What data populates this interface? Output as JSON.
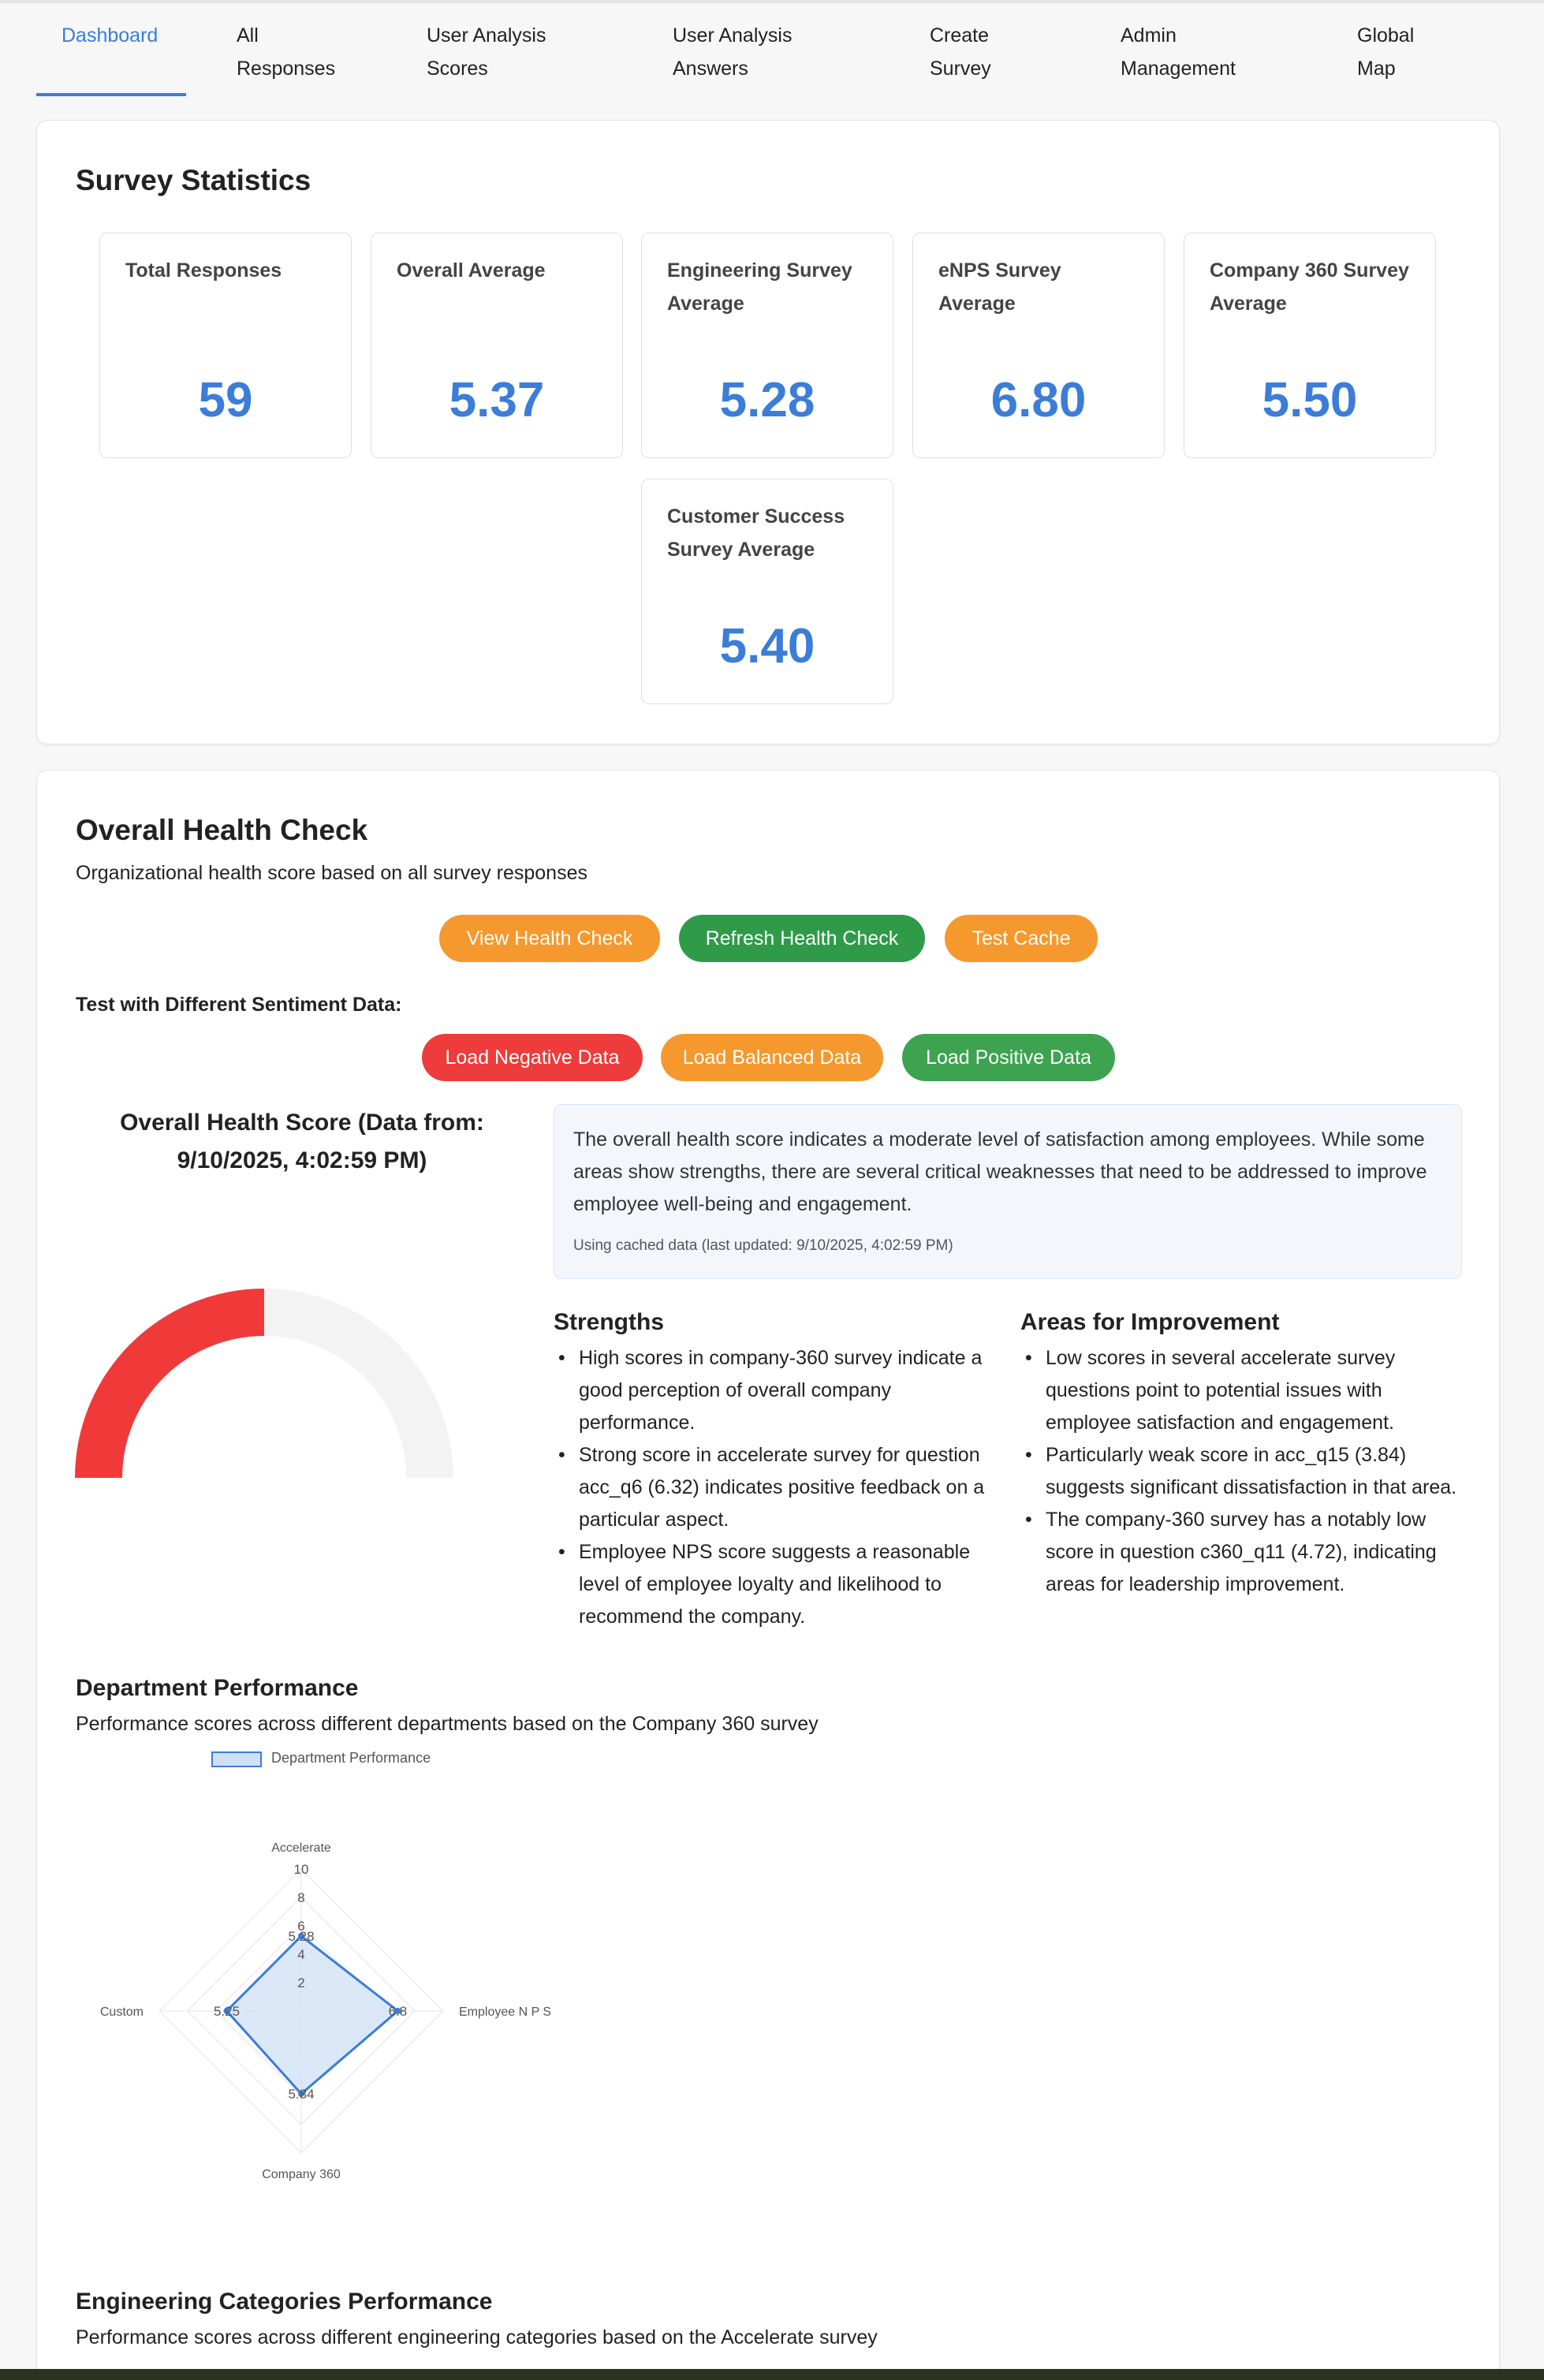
{
  "nav": {
    "tabs": [
      {
        "line1": "Dashboard",
        "line2": ""
      },
      {
        "line1": "All",
        "line2": "Responses"
      },
      {
        "line1": "User Analysis",
        "line2": "Scores"
      },
      {
        "line1": "User Analysis",
        "line2": "Answers"
      },
      {
        "line1": "Create",
        "line2": "Survey"
      },
      {
        "line1": "Admin",
        "line2": "Management"
      },
      {
        "line1": "Global",
        "line2": "Map"
      }
    ]
  },
  "stats": {
    "title": "Survey Statistics",
    "items": [
      {
        "label": "Total Responses",
        "value": "59"
      },
      {
        "label": "Overall Average",
        "value": "5.37"
      },
      {
        "label": "Engineering Survey Average",
        "value": "5.28"
      },
      {
        "label": "eNPS Survey Average",
        "value": "6.80"
      },
      {
        "label": "Company 360 Survey Average",
        "value": "5.50"
      },
      {
        "label": "Customer Success Survey Average",
        "value": "5.40"
      }
    ]
  },
  "health": {
    "title": "Overall Health Check",
    "subtitle": "Organizational health score based on all survey responses",
    "buttons": {
      "view": "View Health Check",
      "refresh": "Refresh Health Check",
      "test_cache": "Test Cache"
    },
    "sentiment_label": "Test with Different Sentiment Data:",
    "sentiment_buttons": {
      "negative": "Load Negative Data",
      "balanced": "Load Balanced Data",
      "positive": "Load Positive Data"
    },
    "score_title": "Overall Health Score (Data from: 9/10/2025, 4:02:59 PM)",
    "gauge_fraction": 0.5,
    "gauge_color": "#f03a3a",
    "summary": "The overall health score indicates a moderate level of satisfaction among employees. While some areas show strengths, there are several critical weaknesses that need to be addressed to improve employee well-being and engagement.",
    "cache_note": "Using cached data (last updated: 9/10/2025, 4:02:59 PM)",
    "strengths_title": "Strengths",
    "strengths": [
      "High scores in company-360 survey indicate a good perception of overall company performance.",
      "Strong score in accelerate survey for question acc_q6 (6.32) indicates positive feedback on a particular aspect.",
      "Employee NPS score suggests a reasonable level of employee loyalty and likelihood to recommend the company."
    ],
    "improvements_title": "Areas for Improvement",
    "improvements": [
      "Low scores in several accelerate survey questions point to potential issues with employee satisfaction and engagement.",
      "Particularly weak score in acc_q15 (3.84) suggests significant dissatisfaction in that area.",
      "The company-360 survey has a notably low score in question c360_q11 (4.72), indicating areas for leadership improvement."
    ]
  },
  "department": {
    "title": "Department Performance",
    "subtitle": "Performance scores across different departments based on the Company 360 survey"
  },
  "engineering": {
    "title": "Engineering Categories Performance",
    "subtitle": "Performance scores across different engineering categories based on the Accelerate survey"
  },
  "chart_data": {
    "type": "radar",
    "categories": [
      "Accelerate",
      "Employee N P S",
      "Company 360",
      "Custom"
    ],
    "series": [
      {
        "name": "Department Performance",
        "values": [
          5.28,
          6.8,
          5.84,
          5.25
        ]
      }
    ],
    "ticks": [
      2,
      4,
      6,
      8,
      10
    ],
    "rlim": [
      0,
      10
    ],
    "data_labels": [
      "5.28",
      "6.8",
      "5.84",
      "5.25"
    ],
    "legend": "top",
    "line_color": "#3b7dd8",
    "fill_color": "#cfe0f5"
  }
}
